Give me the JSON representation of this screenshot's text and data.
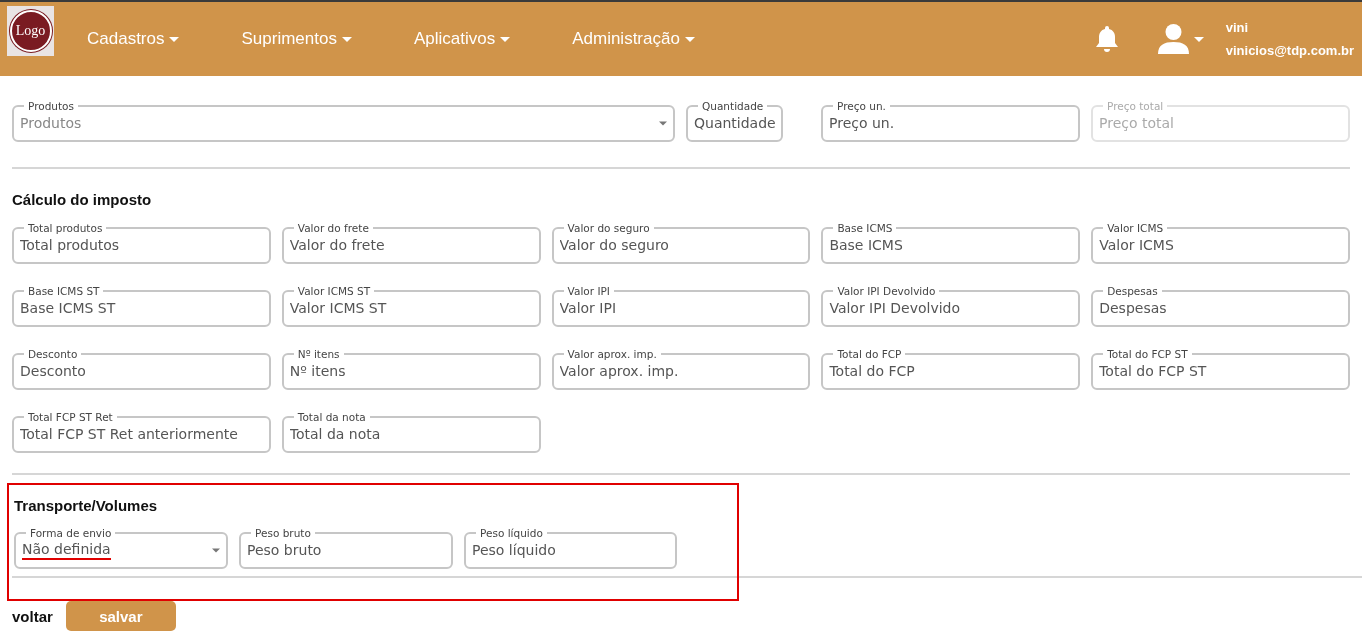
{
  "navbar": {
    "logo": "Logo",
    "menus": [
      {
        "label": "Cadastros"
      },
      {
        "label": "Suprimentos"
      },
      {
        "label": "Aplicativos"
      },
      {
        "label": "Administração"
      }
    ],
    "user": {
      "name": "vini",
      "email": "vinicios@tdp.com.br"
    }
  },
  "product_row": [
    {
      "kind": "select",
      "label": "Produtos",
      "placeholder": "Produtos",
      "disabled": false
    },
    {
      "kind": "text",
      "label": "Quantidade",
      "placeholder": "Quantidade",
      "disabled": false
    },
    {
      "kind": "text",
      "label": "Preço un.",
      "placeholder": "Preço un.",
      "disabled": false
    },
    {
      "kind": "text",
      "label": "Preço total",
      "placeholder": "Preço total",
      "disabled": true
    }
  ],
  "tax_section": {
    "title": "Cálculo do imposto",
    "fields": [
      {
        "label": "Total produtos",
        "placeholder": "Total produtos"
      },
      {
        "label": "Valor do frete",
        "placeholder": "Valor do frete"
      },
      {
        "label": "Valor do seguro",
        "placeholder": "Valor do seguro"
      },
      {
        "label": "Base ICMS",
        "placeholder": "Base ICMS"
      },
      {
        "label": "Valor ICMS",
        "placeholder": "Valor ICMS"
      },
      {
        "label": "Base ICMS ST",
        "placeholder": "Base ICMS ST"
      },
      {
        "label": "Valor ICMS ST",
        "placeholder": "Valor ICMS ST"
      },
      {
        "label": "Valor IPI",
        "placeholder": "Valor IPI"
      },
      {
        "label": "Valor IPI Devolvido",
        "placeholder": "Valor IPI Devolvido"
      },
      {
        "label": "Despesas",
        "placeholder": "Despesas"
      },
      {
        "label": "Desconto",
        "placeholder": "Desconto"
      },
      {
        "label": "Nº itens",
        "placeholder": "Nº itens"
      },
      {
        "label": "Valor aprox. imp.",
        "placeholder": "Valor aprox. imp."
      },
      {
        "label": "Total do FCP",
        "placeholder": "Total do FCP"
      },
      {
        "label": "Total do FCP ST",
        "placeholder": "Total do FCP ST"
      },
      {
        "label": "Total FCP ST Ret",
        "placeholder": "Total FCP ST Ret anteriormente"
      },
      {
        "label": "Total da nota",
        "placeholder": "Total da nota"
      }
    ]
  },
  "transport_section": {
    "title": "Transporte/Volumes",
    "highlighted": true,
    "fields": [
      {
        "kind": "select",
        "label": "Forma de envio",
        "value": "Não definida",
        "underlined": true
      },
      {
        "kind": "text",
        "label": "Peso bruto",
        "placeholder": "Peso bruto"
      },
      {
        "kind": "text",
        "label": "Peso líquido",
        "placeholder": "Peso líquido"
      }
    ]
  },
  "actions": {
    "back": "voltar",
    "save": "salvar"
  }
}
